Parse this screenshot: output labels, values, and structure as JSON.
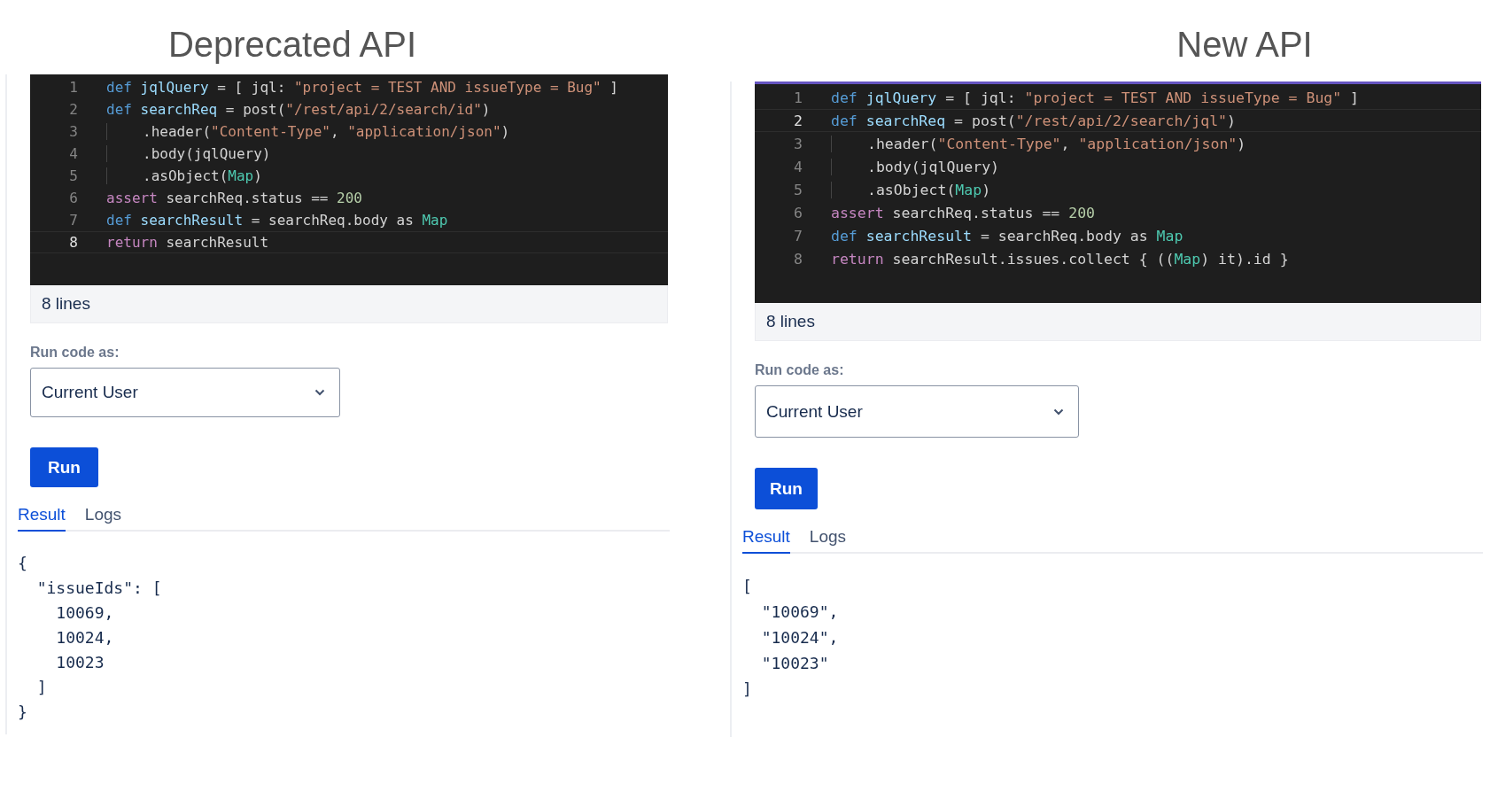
{
  "panels": [
    {
      "title": "Deprecated API",
      "accent": false,
      "code": [
        {
          "number": "1",
          "active": false,
          "indent": false,
          "tokens": [
            {
              "kind": "kw",
              "text": "def"
            },
            {
              "kind": "var",
              "text": " jqlQuery"
            },
            {
              "kind": "plain",
              "text": " = [ jql: "
            },
            {
              "kind": "str",
              "text": "\"project = TEST AND issueType = Bug\""
            },
            {
              "kind": "plain",
              "text": " ]"
            }
          ]
        },
        {
          "number": "2",
          "active": false,
          "indent": false,
          "tokens": [
            {
              "kind": "kw",
              "text": "def"
            },
            {
              "kind": "var",
              "text": " searchReq"
            },
            {
              "kind": "plain",
              "text": " = post("
            },
            {
              "kind": "str",
              "text": "\"/rest/api/2/search/id\""
            },
            {
              "kind": "plain",
              "text": ")"
            }
          ]
        },
        {
          "number": "3",
          "active": false,
          "indent": true,
          "tokens": [
            {
              "kind": "plain",
              "text": ".header("
            },
            {
              "kind": "str",
              "text": "\"Content-Type\""
            },
            {
              "kind": "plain",
              "text": ", "
            },
            {
              "kind": "str",
              "text": "\"application/json\""
            },
            {
              "kind": "plain",
              "text": ")"
            }
          ]
        },
        {
          "number": "4",
          "active": false,
          "indent": true,
          "tokens": [
            {
              "kind": "plain",
              "text": ".body(jqlQuery)"
            }
          ]
        },
        {
          "number": "5",
          "active": false,
          "indent": true,
          "tokens": [
            {
              "kind": "plain",
              "text": ".asObject("
            },
            {
              "kind": "cls",
              "text": "Map"
            },
            {
              "kind": "plain",
              "text": ")"
            }
          ]
        },
        {
          "number": "6",
          "active": false,
          "indent": false,
          "tokens": [
            {
              "kind": "ctl",
              "text": "assert"
            },
            {
              "kind": "plain",
              "text": " searchReq.status == "
            },
            {
              "kind": "num",
              "text": "200"
            }
          ]
        },
        {
          "number": "7",
          "active": false,
          "indent": false,
          "tokens": [
            {
              "kind": "kw",
              "text": "def"
            },
            {
              "kind": "var",
              "text": " searchResult"
            },
            {
              "kind": "plain",
              "text": " = searchReq.body as "
            },
            {
              "kind": "cls",
              "text": "Map"
            }
          ]
        },
        {
          "number": "8",
          "active": true,
          "indent": false,
          "tokens": [
            {
              "kind": "ctl",
              "text": "return"
            },
            {
              "kind": "plain",
              "text": " searchResult"
            }
          ]
        }
      ],
      "line_count": "8 lines",
      "run_as_label": "Run code as:",
      "run_as_value": "Current User",
      "run_button": "Run",
      "tabs": [
        {
          "label": "Result",
          "selected": true
        },
        {
          "label": "Logs",
          "selected": false
        }
      ],
      "result": [
        "{",
        "  \"issueIds\": [",
        "    10069,",
        "    10024,",
        "    10023",
        "  ]",
        "}"
      ]
    },
    {
      "title": "New API",
      "accent": true,
      "code": [
        {
          "number": "1",
          "active": false,
          "indent": false,
          "tokens": [
            {
              "kind": "kw",
              "text": "def"
            },
            {
              "kind": "var",
              "text": " jqlQuery"
            },
            {
              "kind": "plain",
              "text": " = [ jql: "
            },
            {
              "kind": "str",
              "text": "\"project = TEST AND issueType = Bug\""
            },
            {
              "kind": "plain",
              "text": " ]"
            }
          ]
        },
        {
          "number": "2",
          "active": true,
          "indent": false,
          "tokens": [
            {
              "kind": "kw",
              "text": "def"
            },
            {
              "kind": "var",
              "text": " searchReq"
            },
            {
              "kind": "plain",
              "text": " = post("
            },
            {
              "kind": "str",
              "text": "\"/rest/api/2/search/jql\""
            },
            {
              "kind": "plain",
              "text": ")"
            }
          ]
        },
        {
          "number": "3",
          "active": false,
          "indent": true,
          "tokens": [
            {
              "kind": "plain",
              "text": ".header("
            },
            {
              "kind": "str",
              "text": "\"Content-Type\""
            },
            {
              "kind": "plain",
              "text": ", "
            },
            {
              "kind": "str",
              "text": "\"application/json\""
            },
            {
              "kind": "plain",
              "text": ")"
            }
          ]
        },
        {
          "number": "4",
          "active": false,
          "indent": true,
          "tokens": [
            {
              "kind": "plain",
              "text": ".body(jqlQuery)"
            }
          ]
        },
        {
          "number": "5",
          "active": false,
          "indent": true,
          "tokens": [
            {
              "kind": "plain",
              "text": ".asObject("
            },
            {
              "kind": "cls",
              "text": "Map"
            },
            {
              "kind": "plain",
              "text": ")"
            }
          ]
        },
        {
          "number": "6",
          "active": false,
          "indent": false,
          "tokens": [
            {
              "kind": "ctl",
              "text": "assert"
            },
            {
              "kind": "plain",
              "text": " searchReq.status == "
            },
            {
              "kind": "num",
              "text": "200"
            }
          ]
        },
        {
          "number": "7",
          "active": false,
          "indent": false,
          "tokens": [
            {
              "kind": "kw",
              "text": "def"
            },
            {
              "kind": "var",
              "text": " searchResult"
            },
            {
              "kind": "plain",
              "text": " = searchReq.body as "
            },
            {
              "kind": "cls",
              "text": "Map"
            }
          ]
        },
        {
          "number": "8",
          "active": false,
          "indent": false,
          "tokens": [
            {
              "kind": "ctl",
              "text": "return"
            },
            {
              "kind": "plain",
              "text": " searchResult.issues.collect { (("
            },
            {
              "kind": "cls",
              "text": "Map"
            },
            {
              "kind": "plain",
              "text": ") it).id }"
            }
          ]
        }
      ],
      "line_count": "8 lines",
      "run_as_label": "Run code as:",
      "run_as_value": "Current User",
      "run_button": "Run",
      "tabs": [
        {
          "label": "Result",
          "selected": true
        },
        {
          "label": "Logs",
          "selected": false
        }
      ],
      "result": [
        "[",
        "  \"10069\",",
        "  \"10024\",",
        "  \"10023\"",
        "]"
      ]
    }
  ]
}
